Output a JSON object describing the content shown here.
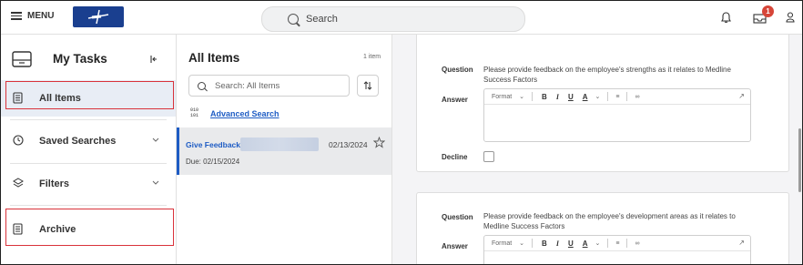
{
  "topbar": {
    "menu_label": "MENU",
    "search_placeholder": "Search",
    "notification_count": "1"
  },
  "sidebar": {
    "title": "My Tasks",
    "items": [
      {
        "label": "All Items"
      },
      {
        "label": "Saved Searches"
      },
      {
        "label": "Filters"
      },
      {
        "label": "Archive"
      }
    ]
  },
  "list": {
    "title": "All Items",
    "count": "1 item",
    "search_placeholder": "Search: All Items",
    "advanced_search": "Advanced Search",
    "rows": [
      {
        "title": "Give Feedback:",
        "date": "02/13/2024",
        "due": "Due: 02/15/2024"
      }
    ]
  },
  "feedback": {
    "question_label": "Question",
    "answer_label": "Answer",
    "decline_label": "Decline",
    "format_label": "Format",
    "q1": "Please provide feedback on the employee's strengths as it relates to Medline Success Factors",
    "q2": "Please provide feedback on the employee's development areas as it relates to Medline Success Factors"
  },
  "colors": {
    "accent": "#1e5cc4",
    "highlight_box": "#d9323a",
    "badge": "#d64538",
    "logo_bg": "#1a3f8f"
  }
}
